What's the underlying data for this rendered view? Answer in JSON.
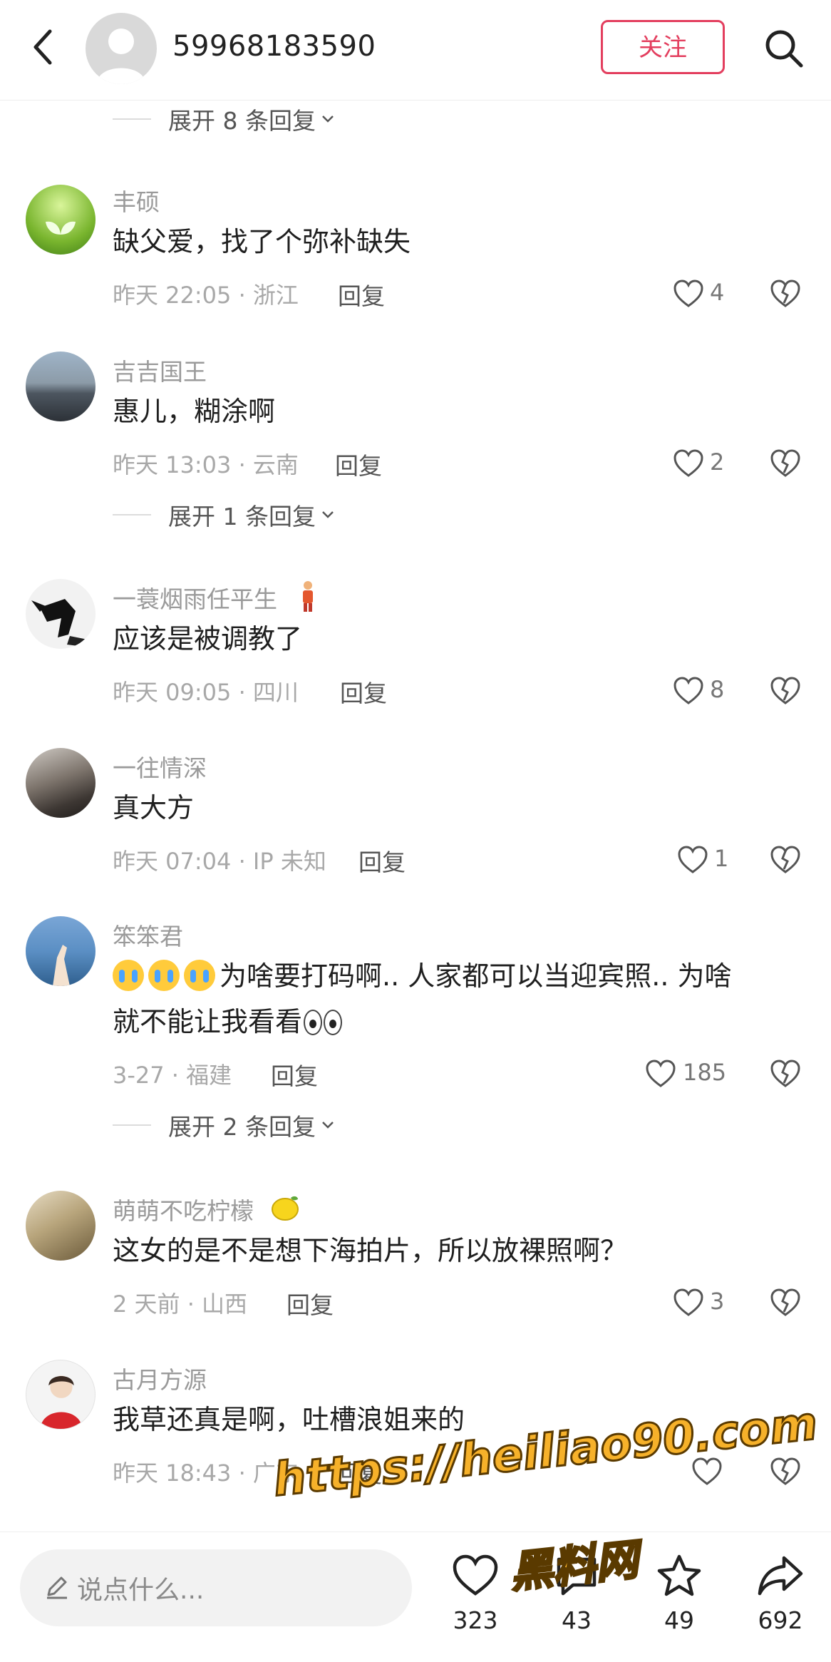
{
  "header": {
    "username": "59968183590",
    "follow_label": "关注"
  },
  "expand_top": "展开 8 条回复",
  "comments": [
    {
      "username": "丰硕",
      "content": "缺父爱，找了个弥补缺失",
      "time": "昨天 22:05 · 浙江",
      "reply": "回复",
      "likes": "4"
    },
    {
      "username": "吉吉国王",
      "content": "惠儿，糊涂啊",
      "time": "昨天 13:03 · 云南",
      "reply": "回复",
      "likes": "2",
      "expand": "展开 1 条回复"
    },
    {
      "username": "一蓑烟雨任平生",
      "content": "应该是被调教了",
      "time": "昨天 09:05 · 四川",
      "reply": "回复",
      "likes": "8"
    },
    {
      "username": "一往情深",
      "content": "真大方",
      "time": "昨天 07:04 · IP 未知",
      "reply": "回复",
      "likes": "1"
    },
    {
      "username": "笨笨君",
      "content_line1": "为啥要打码啊.. 人家都可以当迎宾照.. 为啥",
      "content_line2": "就不能让我看看",
      "time": "3-27 · 福建",
      "reply": "回复",
      "likes": "185",
      "expand": "展开 2 条回复"
    },
    {
      "username": "萌萌不吃柠檬",
      "content": "这女的是不是想下海拍片，所以放裸照啊？",
      "time": "2 天前 · 山西",
      "reply": "回复",
      "likes": "3"
    },
    {
      "username": "古月方源",
      "content": "我草还真是啊，吐槽浪姐来的",
      "time": "昨天 18:43 · 广东",
      "reply": "回复"
    }
  ],
  "bottom_bar": {
    "input_placeholder": "说点什么...",
    "likes": "323",
    "comments": "43",
    "favorites": "49",
    "shares": "692"
  },
  "watermark": {
    "url": "https://heiliao90.com",
    "name": "黑料网"
  },
  "colors": {
    "accent": "#e33e5e",
    "watermark": "#f6b12a"
  }
}
